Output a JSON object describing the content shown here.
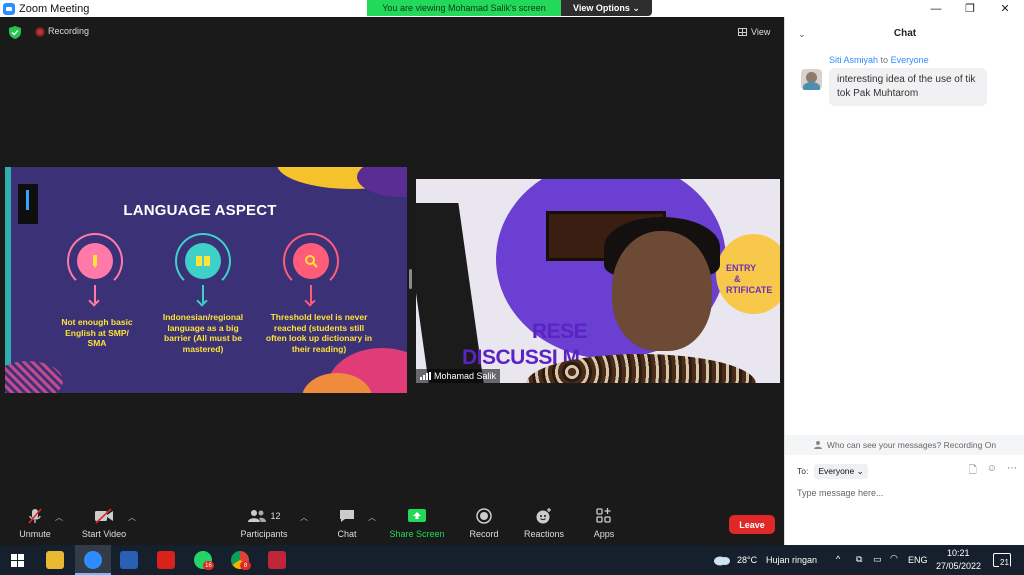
{
  "window": {
    "title": "Zoom Meeting",
    "minimize_glyph": "—",
    "restore_glyph": "❐",
    "close_glyph": "✕"
  },
  "banner": {
    "viewing_text": "You are viewing Mohamad Salik's screen",
    "view_options_label": "View Options ⌄"
  },
  "status": {
    "recording_label": "Recording",
    "view_label": "View"
  },
  "slide": {
    "title": "LANGUAGE ASPECT",
    "items": [
      {
        "text": "Not enough basic English at SMP/ SMA",
        "icon": "pencil-icon",
        "ring_color": "#ff7aa8",
        "fill_color": "#ff7aa8"
      },
      {
        "text": "Indonesian/regional language as a big barrier (All must be mastered)",
        "icon": "book-icon",
        "ring_color": "#3fd0c8",
        "fill_color": "#3fd0c8"
      },
      {
        "text": "Threshold level is never reached (students still often look up dictionary in their reading)",
        "icon": "magnifier-icon",
        "ring_color": "#ff5c7a",
        "fill_color": "#ff5c7a"
      }
    ]
  },
  "video": {
    "participant_name": "Mohamad Salik",
    "backdrop_line1": "RESE",
    "backdrop_line2": "DISCUSSI M",
    "backdrop_cert1": "ENTRY",
    "backdrop_cert2": "&",
    "backdrop_cert3": "RTIFICATE"
  },
  "toolbar": {
    "unmute": "Unmute",
    "start_video": "Start Video",
    "participants": "Participants",
    "participants_count": "12",
    "chat": "Chat",
    "share_screen": "Share Screen",
    "record": "Record",
    "reactions": "Reactions",
    "apps": "Apps",
    "leave": "Leave"
  },
  "chat": {
    "title": "Chat",
    "message": {
      "sender": "Siti Asmiyah",
      "to_word": "to",
      "recipient": "Everyone",
      "text": "interesting idea of the use of tik tok Pak Muhtarom"
    },
    "privacy_notice": "Who can see your messages? Recording On",
    "to_label": "To:",
    "to_value": "Everyone",
    "input_placeholder": "Type message here..."
  },
  "taskbar": {
    "weather_temp": "28°C",
    "weather_desc": "Hujan ringan",
    "language": "ENG",
    "time": "10:21",
    "date": "27/05/2022",
    "whatsapp_badge": "16",
    "chrome_badge": "8",
    "notification_count": "21"
  },
  "colors": {
    "zoom_blue": "#2d8cff",
    "share_green": "#23d959",
    "leave_red": "#e02828",
    "slide_text_yellow": "#ffe23a",
    "slide_bg": "#3a3177"
  }
}
